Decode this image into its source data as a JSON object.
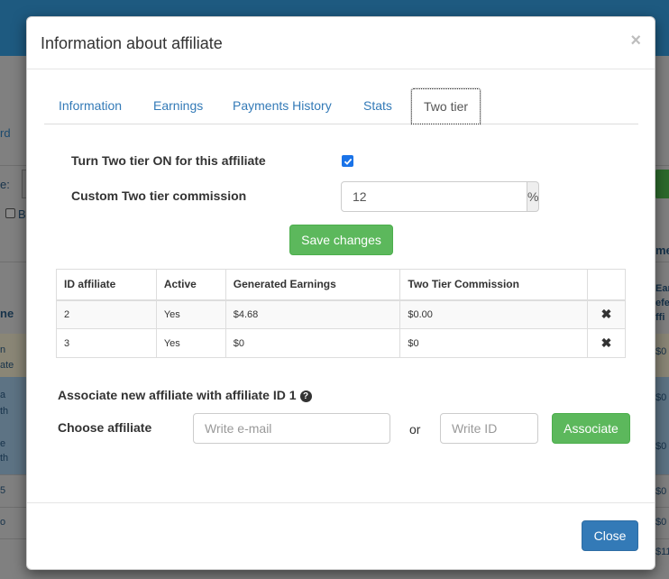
{
  "background": {
    "texts": [
      "rd",
      "e:",
      "B",
      "me",
      "ne",
      "Ear",
      "efe",
      "ffi",
      "n",
      "ate",
      "a",
      "th",
      "e",
      "th",
      "5",
      "o",
      "$0",
      "$0",
      "$0",
      "$0",
      "$0",
      "$11"
    ]
  },
  "modal": {
    "title": "Information about affiliate",
    "close_symbol": "×",
    "tabs": [
      {
        "label": "Information"
      },
      {
        "label": "Earnings"
      },
      {
        "label": "Payments History"
      },
      {
        "label": "Stats"
      },
      {
        "label": "Two tier",
        "active": true
      }
    ],
    "two_tier_on_label": "Turn Two tier ON for this affiliate",
    "two_tier_on_checked": true,
    "custom_commission_label": "Custom Two tier commission",
    "custom_commission_value": "12",
    "commission_unit": "%",
    "save_button": "Save changes",
    "table": {
      "headers": [
        "ID affiliate",
        "Active",
        "Generated Earnings",
        "Two Tier Commission",
        ""
      ],
      "rows": [
        {
          "id": "2",
          "active": "Yes",
          "earnings": "$4.68",
          "commission": "$0.00",
          "remove": "✖"
        },
        {
          "id": "3",
          "active": "Yes",
          "earnings": "$0",
          "commission": "$0",
          "remove": "✖"
        }
      ]
    },
    "associate_heading": "Associate new affiliate with affiliate ID 1",
    "help_symbol": "?",
    "choose_affiliate_label": "Choose affiliate",
    "email_placeholder": "Write e-mail",
    "or_text": "or",
    "id_placeholder": "Write ID",
    "associate_button": "Associate",
    "close_button": "Close"
  },
  "colors": {
    "primary": "#337ab7",
    "success": "#5cb85c",
    "checkbox": "#1a73e8"
  }
}
